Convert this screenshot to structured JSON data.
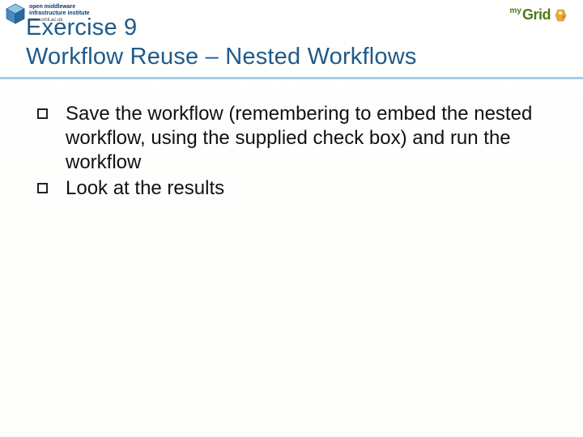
{
  "logos": {
    "left": {
      "org_line": "open middleware",
      "sub_line": "infrastructure institute",
      "url_line": "www.omii.ac.uk"
    },
    "right": {
      "my": "my",
      "grid": "Grid"
    }
  },
  "title": {
    "line1": "Exercise 9",
    "line2": "Workflow Reuse – Nested Workflows"
  },
  "bullets": [
    "Save the workflow (remembering to embed the nested workflow, using the supplied check box) and run the workflow",
    "Look at the results"
  ]
}
